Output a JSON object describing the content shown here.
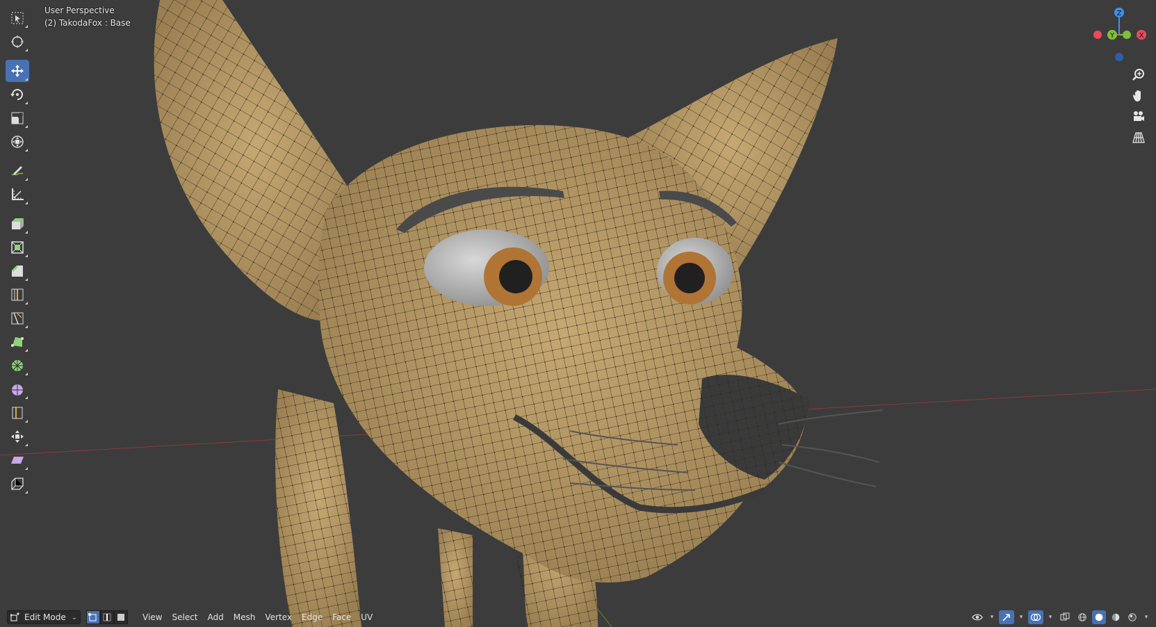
{
  "viewport": {
    "view_name": "User Perspective",
    "object_info": "(2) TakodaFox : Base"
  },
  "toolbar": {
    "tools": [
      {
        "name": "select-box-tool",
        "icon": "select-box-icon",
        "active": false
      },
      {
        "name": "cursor-tool",
        "icon": "cursor-icon",
        "active": false
      },
      {
        "name": "move-tool",
        "icon": "move-icon",
        "active": true
      },
      {
        "name": "rotate-tool",
        "icon": "rotate-icon",
        "active": false
      },
      {
        "name": "scale-tool",
        "icon": "scale-icon",
        "active": false
      },
      {
        "name": "transform-tool",
        "icon": "transform-icon",
        "active": false
      },
      {
        "name": "annotate-tool",
        "icon": "annotate-icon",
        "active": false
      },
      {
        "name": "measure-tool",
        "icon": "measure-icon",
        "active": false
      },
      {
        "name": "extrude-region-tool",
        "icon": "extrude-icon",
        "active": false
      },
      {
        "name": "inset-faces-tool",
        "icon": "inset-icon",
        "active": false
      },
      {
        "name": "bevel-tool",
        "icon": "bevel-icon",
        "active": false
      },
      {
        "name": "loop-cut-tool",
        "icon": "loop-cut-icon",
        "active": false
      },
      {
        "name": "knife-tool",
        "icon": "knife-icon",
        "active": false
      },
      {
        "name": "poly-build-tool",
        "icon": "poly-build-icon",
        "active": false
      },
      {
        "name": "spin-tool",
        "icon": "spin-icon",
        "active": false
      },
      {
        "name": "smooth-tool",
        "icon": "smooth-icon",
        "active": false
      },
      {
        "name": "edge-slide-tool",
        "icon": "edge-slide-icon",
        "active": false
      },
      {
        "name": "shrink-fatten-tool",
        "icon": "shrink-fatten-icon",
        "active": false
      },
      {
        "name": "shear-tool",
        "icon": "shear-icon",
        "active": false
      },
      {
        "name": "rip-region-tool",
        "icon": "rip-icon",
        "active": false
      }
    ]
  },
  "gizmo": {
    "x_label": "X",
    "y_label": "Y",
    "z_label": "Z",
    "x_color": "#e84b5c",
    "y_color": "#7fbf3a",
    "z_color": "#3f8ff0"
  },
  "header": {
    "mode": "Edit Mode",
    "select_modes": [
      "vertex-select",
      "edge-select",
      "face-select"
    ],
    "menus": [
      "View",
      "Select",
      "Add",
      "Mesh",
      "Vertex",
      "Edge",
      "Face",
      "UV"
    ]
  },
  "colors": {
    "background": "#3c3c3c",
    "mesh": "#b59863",
    "accent": "#4772b3"
  }
}
